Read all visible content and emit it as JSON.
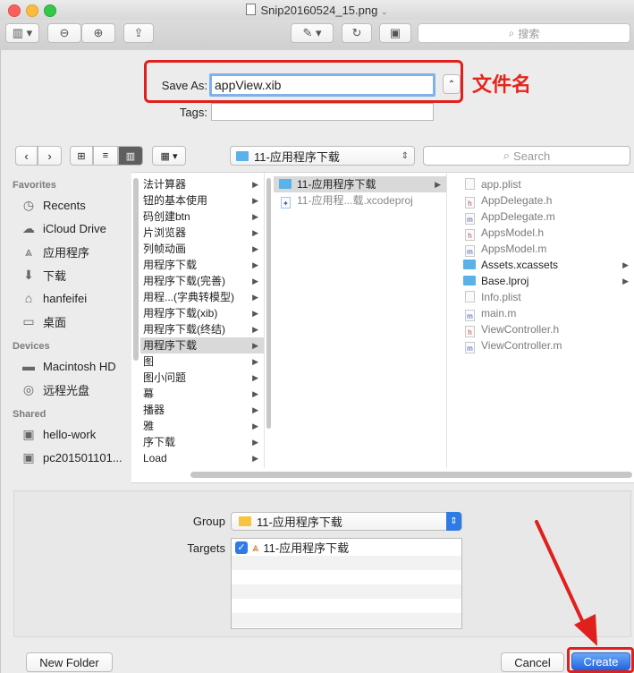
{
  "window": {
    "title": "Snip20160524_15.png"
  },
  "toolbar": {
    "search_placeholder": "搜索"
  },
  "save": {
    "label": "Save As:",
    "value": "appView.xib",
    "tags_label": "Tags:"
  },
  "annotation": {
    "text": "文件名"
  },
  "nav": {
    "path_current": "11-应用程序下载",
    "search_placeholder": "Search"
  },
  "sidebar": {
    "favorites_header": "Favorites",
    "favorites": [
      {
        "label": "Recents",
        "icon": "clock-icon"
      },
      {
        "label": "iCloud Drive",
        "icon": "cloud-icon"
      },
      {
        "label": "应用程序",
        "icon": "applications-icon"
      },
      {
        "label": "下载",
        "icon": "download-icon"
      },
      {
        "label": "hanfeifei",
        "icon": "home-icon"
      },
      {
        "label": "桌面",
        "icon": "desktop-icon"
      }
    ],
    "devices_header": "Devices",
    "devices": [
      {
        "label": "Macintosh HD",
        "icon": "hard-drive-icon"
      },
      {
        "label": "远程光盘",
        "icon": "disc-icon"
      }
    ],
    "shared_header": "Shared",
    "shared": [
      {
        "label": "hello-work",
        "icon": "computer-icon"
      },
      {
        "label": "pc201501101...",
        "icon": "computer-icon"
      }
    ]
  },
  "columns": {
    "col1": [
      "法计算器",
      "钮的基本使用",
      "码创建btn",
      "片浏览器",
      "列帧动画",
      "用程序下载",
      "用程序下载(完善)",
      "用程...(字典转模型)",
      "用程序下载(xib)",
      "用程序下载(终结)",
      "用程序下载",
      "图",
      "图小问题",
      "幕",
      "播器",
      "雅",
      "序下载",
      "Load"
    ],
    "col2": [
      {
        "label": "11-应用程序下载",
        "type": "folder"
      },
      {
        "label": "11-应用程...载.xcodeproj",
        "type": "project"
      }
    ],
    "col3": [
      {
        "label": "app.plist",
        "type": "plist"
      },
      {
        "label": "AppDelegate.h",
        "type": "h"
      },
      {
        "label": "AppDelegate.m",
        "type": "m"
      },
      {
        "label": "AppsModel.h",
        "type": "h"
      },
      {
        "label": "AppsModel.m",
        "type": "m"
      },
      {
        "label": "Assets.xcassets",
        "type": "folder"
      },
      {
        "label": "Base.lproj",
        "type": "folder"
      },
      {
        "label": "Info.plist",
        "type": "plist"
      },
      {
        "label": "main.m",
        "type": "m"
      },
      {
        "label": "ViewController.h",
        "type": "h"
      },
      {
        "label": "ViewController.m",
        "type": "m"
      }
    ]
  },
  "lower": {
    "group_label": "Group",
    "group_value": "11-应用程序下载",
    "targets_label": "Targets",
    "target_item": "11-应用程序下载"
  },
  "buttons": {
    "new_folder": "New Folder",
    "cancel": "Cancel",
    "create": "Create"
  },
  "colors": {
    "annotation_red": "#e0201d",
    "accent_blue": "#2e7be6"
  }
}
